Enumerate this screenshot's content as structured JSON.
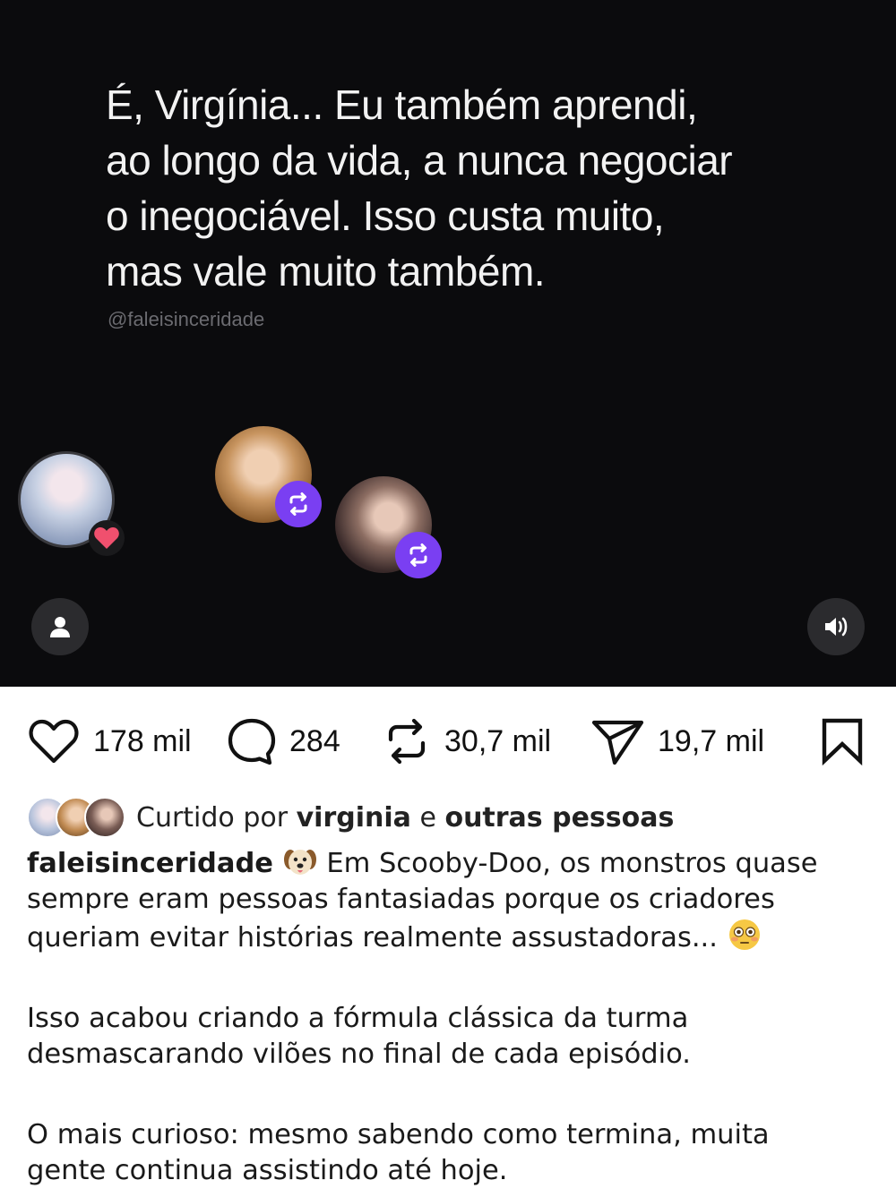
{
  "media": {
    "quote_lines": [
      "É, Virgínia... Eu também aprendi,",
      "ao longo da vida, a nunca negociar",
      "o inegociável. Isso custa muito,",
      "mas vale muito também."
    ],
    "handle": "@faleisinceridade"
  },
  "actions": {
    "likes": "178 mil",
    "comments": "284",
    "reposts": "30,7 mil",
    "shares": "19,7 mil"
  },
  "liked_by": {
    "prefix": "Curtido por",
    "user": "virginia",
    "connector": "e",
    "others": "outras pessoas"
  },
  "caption": {
    "username": "faleisinceridade",
    "line1_rest": "Em Scooby-Doo, os monstros quase",
    "line2": "sempre eram pessoas fantasiadas porque os criadores",
    "line3": "queriam evitar histórias realmente assustadoras...",
    "para2_line1": "Isso acabou criando a fórmula clássica da turma",
    "para2_line2": "desmascarando vilões no final de cada episódio.",
    "para3_line1": "O mais curioso: mesmo sabendo como termina, muita",
    "para3_line2": "gente continua assistindo até hoje."
  },
  "icons": {
    "accent_purple": "#7a3ff2",
    "heart_badge": "#f0506e"
  }
}
